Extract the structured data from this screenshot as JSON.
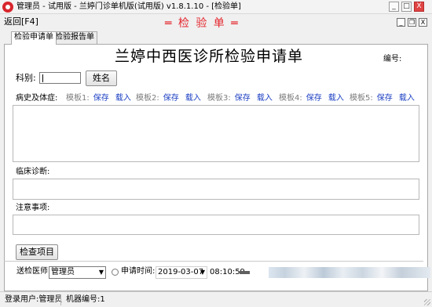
{
  "window": {
    "title": "管理员 - 试用版 - 兰婷门诊单机版(试用版) v1.8.1.10 - [检验单]",
    "min_glyph": "_",
    "max_glyph": "□",
    "close_glyph": "X"
  },
  "toolbar": {
    "back_label": "返回[F4]",
    "banner": "═ 检 验 单 ═",
    "child_min_glyph": "_",
    "child_restore_glyph": "❐",
    "child_close_glyph": "X"
  },
  "tabs": [
    {
      "label": "检验申请单",
      "active": true
    },
    {
      "label": "检验报告单",
      "active": false
    }
  ],
  "form": {
    "title": "兰婷中西医诊所检验申请单",
    "serial_label": "编号:",
    "dept_label": "科别:",
    "dept_value": "",
    "name_button": "姓名",
    "history_label": "病史及体症:",
    "templates": [
      {
        "name": "模板1:",
        "save": "保存",
        "load": "载入"
      },
      {
        "name": "模板2:",
        "save": "保存",
        "load": "载入"
      },
      {
        "name": "模板3:",
        "save": "保存",
        "load": "载入"
      },
      {
        "name": "模板4:",
        "save": "保存",
        "load": "载入"
      },
      {
        "name": "模板5:",
        "save": "保存",
        "load": "载入"
      }
    ],
    "history_value": "",
    "diagnosis_label": "临床诊断:",
    "diagnosis_value": "",
    "notes_label": "注意事项:",
    "notes_value": "",
    "check_items_button": "检查项目"
  },
  "bottom": {
    "doctor_label": "送检医师:",
    "doctor_value": "管理员",
    "request_time_label": "申请时间:",
    "date_value": "2019-03-07",
    "time_value": "08:10:59"
  },
  "status": {
    "user_label": "登录用户:管理员",
    "machine_label": "机器编号:1"
  }
}
